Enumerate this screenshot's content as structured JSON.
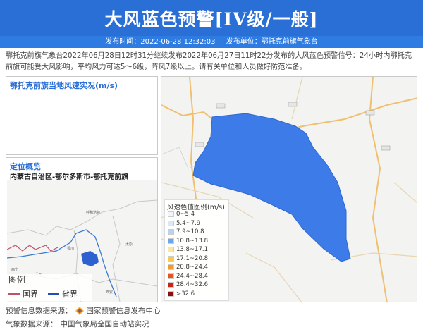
{
  "header": {
    "title": "大风蓝色预警[IV级/一般]",
    "publish_time_label": "发布时间：2022-06-28 12:32:03",
    "publisher_label": "发布单位：鄂托克前旗气象台"
  },
  "description": "鄂托克前旗气象台2022年06月28日12时31分继续发布2022年06月27日11时22分发布的大风蓝色预警信号：24小时内鄂托克前旗可能受大风影响，平均风力可达5～6级，阵风7级以上。请有关单位和人员做好防范准备。",
  "wind_panel": {
    "title": "鄂托克前旗当地风速实况(m/s)"
  },
  "location_panel": {
    "title": "定位概览",
    "region": "内蒙古自治区-鄂尔多斯市-鄂托克前旗",
    "map_labels": [
      "呼和浩特",
      "银川",
      "太原",
      "西宁",
      "兰州",
      "西安"
    ],
    "legend": {
      "title": "图例",
      "items": [
        {
          "label": "国界",
          "color": "#c0506a"
        },
        {
          "label": "省界",
          "color": "#1f4fb8"
        }
      ]
    }
  },
  "speed_legend": {
    "title": "风速色值图例(m/s)",
    "items": [
      {
        "label": "0~5.4",
        "color": "#f2f6fb"
      },
      {
        "label": "5.4~7.9",
        "color": "#dbe8f7"
      },
      {
        "label": "7.9~10.8",
        "color": "#b7d3f1"
      },
      {
        "label": "10.8~13.8",
        "color": "#6aa7e6"
      },
      {
        "label": "13.8~17.1",
        "color": "#fbe7a5"
      },
      {
        "label": "17.1~20.8",
        "color": "#f7c94d"
      },
      {
        "label": "20.8~24.4",
        "color": "#f39a2b"
      },
      {
        "label": "24.4~28.4",
        "color": "#e8541e"
      },
      {
        "label": "28.4~32.6",
        "color": "#c8241a"
      },
      {
        "label": ">32.6",
        "color": "#8b0f0f"
      }
    ]
  },
  "footer": {
    "source1_label": "预警信息数据来源：",
    "source1_value": "国家预警信息发布中心",
    "source2_label": "气象数据来源：",
    "source2_value": "中国气象局全国自动站实况"
  },
  "colors": {
    "header_bg": "#2a6fd6",
    "warning_area": "#3d7be8"
  }
}
